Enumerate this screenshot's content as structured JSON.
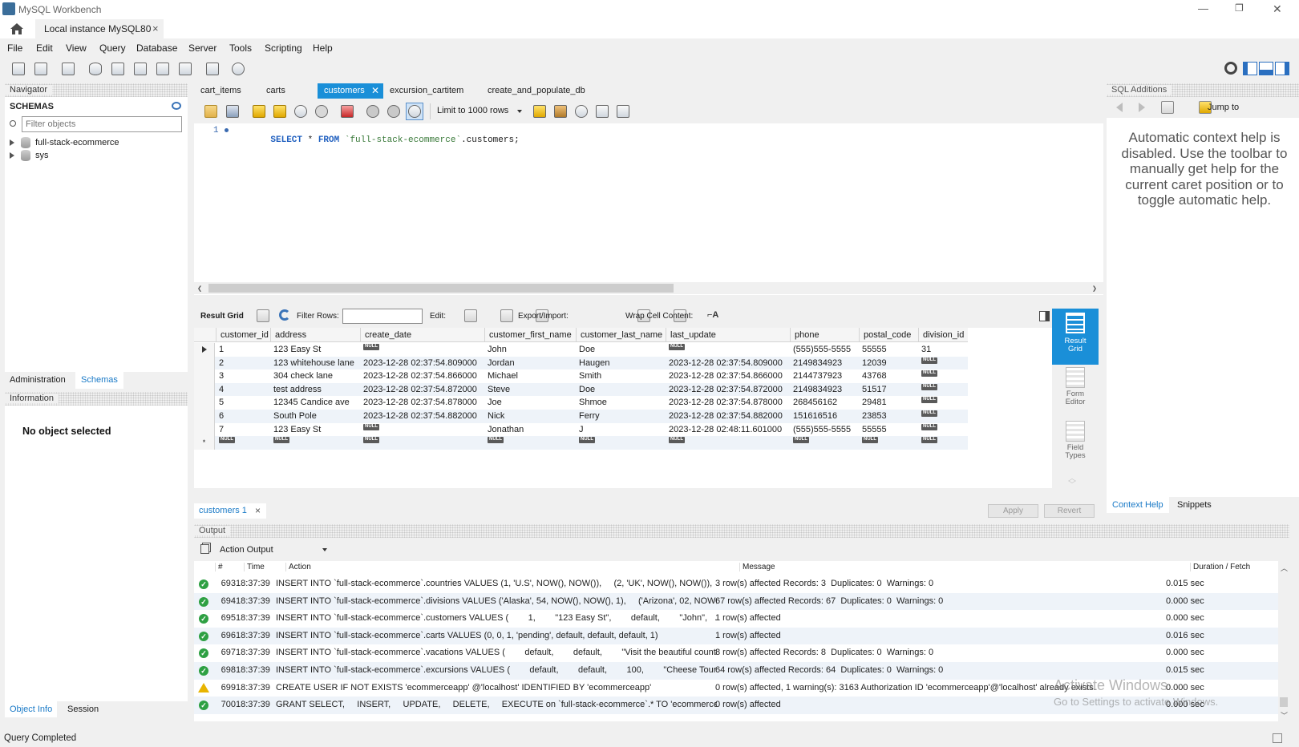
{
  "window": {
    "title": "MySQL Workbench",
    "min": "—",
    "restore": "❐",
    "close": "✕"
  },
  "conn_tab": {
    "label": "Local instance MySQL80",
    "close": "×"
  },
  "menu": [
    "File",
    "Edit",
    "View",
    "Query",
    "Database",
    "Server",
    "Tools",
    "Scripting",
    "Help"
  ],
  "navigator": {
    "header": "Navigator",
    "schemas_title": "SCHEMAS",
    "filter_placeholder": "Filter objects",
    "schemas": [
      "full-stack-ecommerce",
      "sys"
    ],
    "tabs": [
      "Administration",
      "Schemas"
    ],
    "info_header": "Information",
    "no_object": "No object selected",
    "bottom_tabs": [
      "Object Info",
      "Session"
    ]
  },
  "editor_tabs": [
    "cart_items",
    "carts",
    "customers",
    "excursion_cartitem",
    "create_and_populate_db"
  ],
  "editor": {
    "limit": "Limit to 1000 rows",
    "line_no": "1",
    "sql_kw1": "SELECT",
    "sql_star": " * ",
    "sql_kw2": "FROM",
    "sql_tbl": "`full-stack-ecommerce`",
    "sql_rest": ".customers;"
  },
  "result_toolbar": {
    "result_grid": "Result Grid",
    "filter_rows": "Filter Rows:",
    "edit": "Edit:",
    "export": "Export/Import:",
    "wrap": "Wrap Cell Content:"
  },
  "grid": {
    "columns": [
      "customer_id",
      "address",
      "create_date",
      "customer_first_name",
      "customer_last_name",
      "last_update",
      "phone",
      "postal_code",
      "division_id"
    ],
    "rows": [
      [
        "1",
        "123 Easy St",
        "NULL",
        "John",
        "Doe",
        "NULL",
        "(555)555-5555",
        "55555",
        "31"
      ],
      [
        "2",
        "123 whitehouse lane",
        "2023-12-28 02:37:54.809000",
        "Jordan",
        "Haugen",
        "2023-12-28 02:37:54.809000",
        "2149834923",
        "12039",
        "NULL"
      ],
      [
        "3",
        "304 check lane",
        "2023-12-28 02:37:54.866000",
        "Michael",
        "Smith",
        "2023-12-28 02:37:54.866000",
        "2144737923",
        "43768",
        "NULL"
      ],
      [
        "4",
        "test address",
        "2023-12-28 02:37:54.872000",
        "Steve",
        "Doe",
        "2023-12-28 02:37:54.872000",
        "2149834923",
        "51517",
        "NULL"
      ],
      [
        "5",
        "12345 Candice ave",
        "2023-12-28 02:37:54.878000",
        "Joe",
        "Shmoe",
        "2023-12-28 02:37:54.878000",
        "268456162",
        "29481",
        "NULL"
      ],
      [
        "6",
        "South Pole",
        "2023-12-28 02:37:54.882000",
        "Nick",
        "Ferry",
        "2023-12-28 02:37:54.882000",
        "151616516",
        "23853",
        "NULL"
      ],
      [
        "7",
        "123 Easy St",
        "NULL",
        "Jonathan",
        "J",
        "2023-12-28 02:48:11.601000",
        "(555)555-5555",
        "55555",
        "NULL"
      ],
      [
        "NULL",
        "NULL",
        "NULL",
        "NULL",
        "NULL",
        "NULL",
        "NULL",
        "NULL",
        "NULL"
      ]
    ],
    "new_row_marker": "*"
  },
  "side_panel": [
    {
      "label": "Result\nGrid"
    },
    {
      "label": "Form\nEditor"
    },
    {
      "label": "Field\nTypes"
    }
  ],
  "result_tab": {
    "label": "customers 1",
    "close": "×",
    "apply": "Apply",
    "revert": "Revert"
  },
  "output": {
    "header": "Output",
    "selector": "Action Output",
    "columns": [
      "#",
      "Time",
      "Action",
      "Message",
      "Duration / Fetch"
    ],
    "rows": [
      {
        "status": "ok",
        "n": "693",
        "time": "18:37:39",
        "action": "INSERT INTO `full-stack-ecommerce`.countries VALUES (1, 'U.S', NOW(), NOW()),     (2, 'UK', NOW(), NOW()),     (...",
        "msg": "3 row(s) affected Records: 3  Duplicates: 0  Warnings: 0",
        "dur": "0.015 sec"
      },
      {
        "status": "ok",
        "n": "694",
        "time": "18:37:39",
        "action": "INSERT INTO `full-stack-ecommerce`.divisions VALUES ('Alaska', 54, NOW(), NOW(), 1),     ('Arizona', 02, NOW(), ...",
        "msg": "67 row(s) affected Records: 67  Duplicates: 0  Warnings: 0",
        "dur": "0.000 sec"
      },
      {
        "status": "ok",
        "n": "695",
        "time": "18:37:39",
        "action": "INSERT INTO `full-stack-ecommerce`.customers VALUES (        1,        \"123 Easy St\",        default,        \"John\",   ...",
        "msg": "1 row(s) affected",
        "dur": "0.000 sec"
      },
      {
        "status": "ok",
        "n": "696",
        "time": "18:37:39",
        "action": "INSERT INTO `full-stack-ecommerce`.carts VALUES (0, 0, 1, 'pending', default, default, default, 1)",
        "msg": "1 row(s) affected",
        "dur": "0.016 sec"
      },
      {
        "status": "ok",
        "n": "697",
        "time": "18:37:39",
        "action": "INSERT INTO `full-stack-ecommerce`.vacations VALUES (        default,        default,        \"Visit the beautiful countr...",
        "msg": "8 row(s) affected Records: 8  Duplicates: 0  Warnings: 0",
        "dur": "0.000 sec"
      },
      {
        "status": "ok",
        "n": "698",
        "time": "18:37:39",
        "action": "INSERT INTO `full-stack-ecommerce`.excursions VALUES (        default,        default,        100,        \"Cheese Tour...",
        "msg": "64 row(s) affected Records: 64  Duplicates: 0  Warnings: 0",
        "dur": "0.015 sec"
      },
      {
        "status": "warn",
        "n": "699",
        "time": "18:37:39",
        "action": "CREATE USER IF NOT EXISTS 'ecommerceapp' @'localhost' IDENTIFIED BY 'ecommerceapp'",
        "msg": "0 row(s) affected, 1 warning(s): 3163 Authorization ID 'ecommerceapp'@'localhost' already exists.",
        "dur": "0.000 sec"
      },
      {
        "status": "ok",
        "n": "700",
        "time": "18:37:39",
        "action": "GRANT SELECT,     INSERT,     UPDATE,     DELETE,     EXECUTE on `full-stack-ecommerce`.* TO 'ecommercea...",
        "msg": "0 row(s) affected",
        "dur": "0.000 sec"
      }
    ]
  },
  "sql_additions": {
    "header": "SQL Additions",
    "jump_to": "Jump to",
    "help": "Automatic context help is disabled. Use the toolbar to manually get help for the current caret position or to toggle automatic help.",
    "tabs": [
      "Context Help",
      "Snippets"
    ]
  },
  "watermark": {
    "line1": "Activate Windows",
    "line2": "Go to Settings to activate Windows."
  },
  "status_bar": "Query Completed",
  "colors": {
    "accent": "#0078d7",
    "tab_active": "#1a8fd8",
    "sql_keyword": "#1f5fbf",
    "sql_string": "#3a7a3a",
    "ok": "#2ea043",
    "warn": "#e8b400"
  }
}
